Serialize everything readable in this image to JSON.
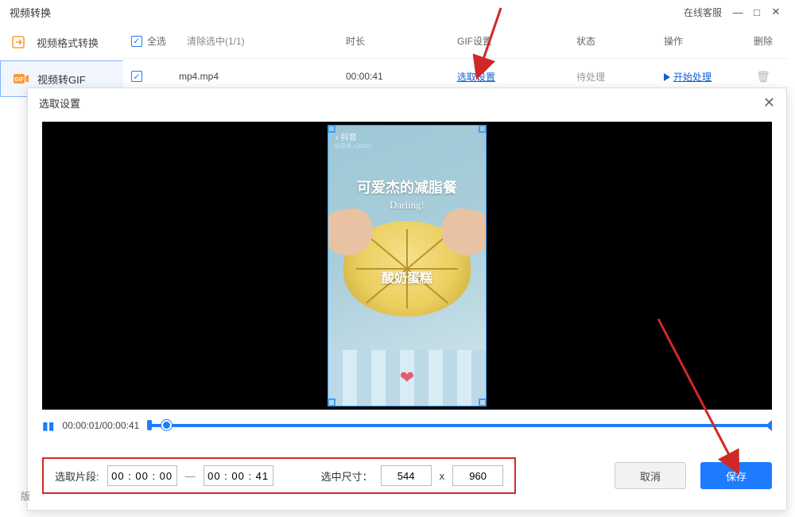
{
  "titlebar": {
    "title": "视频转换",
    "online": "在线客服"
  },
  "nav": {
    "items": [
      {
        "label": "视频格式转换"
      },
      {
        "label": "视频转GIF"
      }
    ]
  },
  "table": {
    "select_all": "全选",
    "clear_selected": "清除选中(1/1)",
    "headers": {
      "duration": "时长",
      "gif": "GIF设置",
      "status": "状态",
      "operate": "操作",
      "delete": "删除"
    },
    "rows": [
      {
        "name": "mp4.mp4",
        "duration": "00:00:41",
        "gif": "选取设置",
        "status": "待处理",
        "operate": "开始处理"
      }
    ]
  },
  "modal": {
    "title": "选取设置",
    "watermark": "抖音",
    "watermark_sub": "抖音号: Lj5183",
    "overlay_title": "可爱杰的减脂餐",
    "overlay_script": "Darling!",
    "overlay_caption": "酸奶蛋糕",
    "time_display": "00:00:01/00:00:41",
    "clip_label": "选取片段:",
    "clip_start": "00 : 00 : 00",
    "clip_end": "00 : 00 : 41",
    "size_label": "选中尺寸：",
    "size_w": "544",
    "size_x": "x",
    "size_h": "960",
    "cancel": "取消",
    "save": "保存"
  }
}
